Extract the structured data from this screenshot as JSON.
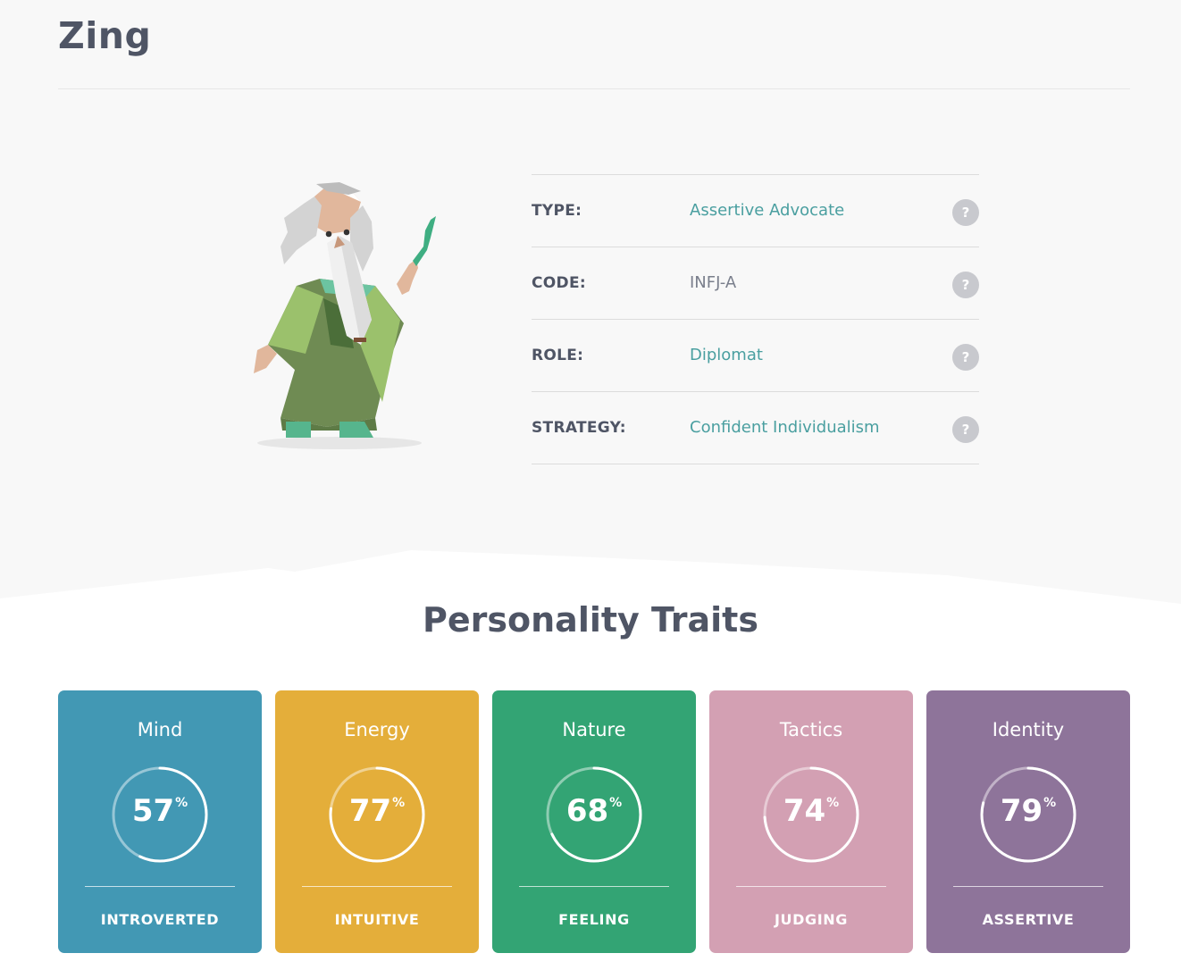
{
  "profile": {
    "name": "Zing"
  },
  "info": [
    {
      "label": "TYPE:",
      "value": "Assertive Advocate",
      "link": true
    },
    {
      "label": "CODE:",
      "value": "INFJ-A",
      "link": false
    },
    {
      "label": "ROLE:",
      "value": "Diplomat",
      "link": true
    },
    {
      "label": "STRATEGY:",
      "value": "Confident Individualism",
      "link": true
    }
  ],
  "help_icon_glyph": "?",
  "traits": {
    "title": "Personality Traits",
    "percent_sign": "%",
    "cards": [
      {
        "category": "Mind",
        "percent": 57,
        "trait": "INTROVERTED",
        "color": "#4298b4"
      },
      {
        "category": "Energy",
        "percent": 77,
        "trait": "INTUITIVE",
        "color": "#e4ae3a"
      },
      {
        "category": "Nature",
        "percent": 68,
        "trait": "FEELING",
        "color": "#33a474"
      },
      {
        "category": "Tactics",
        "percent": 74,
        "trait": "JUDGING",
        "color": "#d3a0b3"
      },
      {
        "category": "Identity",
        "percent": 79,
        "trait": "ASSERTIVE",
        "color": "#8e749a"
      }
    ]
  },
  "colors": {
    "link": "#4a9fa0",
    "heading": "#4f5565",
    "top_background": "#f8f8f8"
  }
}
